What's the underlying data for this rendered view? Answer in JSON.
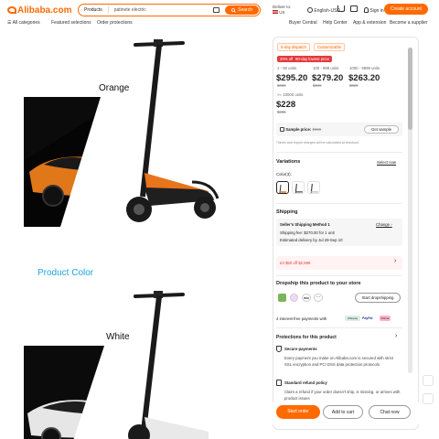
{
  "header": {
    "logo": "Alibaba.com",
    "search": {
      "category": "Products",
      "value": "patinete electric",
      "button": "Search"
    },
    "deliver_to": {
      "label": "Deliver to:",
      "country": "US"
    },
    "language": "English-USD",
    "sign_in": "Sign in",
    "create_account": "Create account",
    "nav_left": [
      "All categories",
      "Featured selections",
      "Order protections"
    ],
    "nav_right": [
      "Buyer Central",
      "Help Center",
      "App & extension",
      "Become a supplier"
    ]
  },
  "gallery": {
    "labels": {
      "orange": "Orange",
      "product_color": "Product Color",
      "white": "White"
    }
  },
  "product": {
    "badges": [
      "5-day dispatch",
      "Customizable"
    ],
    "promo": [
      "20% off",
      "90-day lowest price"
    ],
    "tiers": [
      {
        "range": "1 - 50 units",
        "price": "$295.20",
        "old": "$369"
      },
      {
        "range": "100 - 999 units",
        "price": "$279.20",
        "old": "$349"
      },
      {
        "range": "1000 - 9999 units",
        "price": "$263.20",
        "old": "$329"
      }
    ],
    "bulk": {
      "range": ">= 10000 units",
      "price": "$228",
      "old": "$285"
    },
    "sample": {
      "label": "Sample price:",
      "price": "$369",
      "button": "Get sample"
    },
    "tax_note": "*Taxes and import charges will be calculated at checkout.",
    "variations": {
      "title": "Variations",
      "select_now": "Select now",
      "color_label": "Color(3):"
    },
    "shipping": {
      "title": "Shipping",
      "method": "Seller's Shipping Method 1",
      "change": "Change",
      "fee": "Shipping fee: $270.00 for 1 unit",
      "delivery": "Estimated delivery by Jul 29-Sep 10"
    },
    "coupon": "£3 $50 off $2,699",
    "dropship": {
      "title": "Dropship this product to your store",
      "button": "Start dropshipping",
      "logos": [
        "",
        "",
        "WIX",
        "···"
      ]
    },
    "payments": {
      "text": "4 interest-free payments with",
      "logos": [
        "Afterpay",
        "PayPal",
        "Klarna"
      ]
    },
    "protections": {
      "title": "Protections for this product",
      "secure_title": "Secure payments",
      "secure_text": "Every payment you make on Alibaba.com is secured with strict SSL encryption and PCI DSS data protection protocols",
      "refund_title": "Standard refund policy",
      "refund_text": "Claim a refund if your order doesn't ship, is missing, or arrives with product issues"
    },
    "actions": {
      "order": "Start order",
      "cart": "Add to cart",
      "chat": "Chat now"
    }
  },
  "colors": {
    "accent": "#ff6a00",
    "link": "#1ea4e0",
    "promo_red": "#e4393c"
  }
}
